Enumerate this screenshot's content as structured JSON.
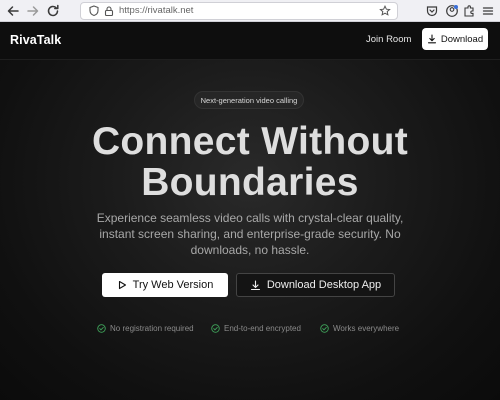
{
  "browser": {
    "url": "https://rivatalk.net",
    "icons": [
      "back-icon",
      "forward-icon",
      "reload-icon",
      "shield-icon",
      "lock-icon",
      "star-icon",
      "pocket-icon",
      "account-icon",
      "extensions-icon",
      "menu-icon"
    ]
  },
  "header": {
    "logo": "RivaTalk",
    "join_label": "Join Room",
    "download_label": "Download"
  },
  "hero": {
    "badge": "Next-generation video calling",
    "title_line1": "Connect Without",
    "title_line2": "Boundaries",
    "subtitle": "Experience seamless video calls with crystal-clear quality, instant screen sharing, and enterprise-grade security. No downloads, no hassle.",
    "primary_cta": "Try Web Version",
    "secondary_cta": "Download Desktop App",
    "features": [
      "No registration required",
      "End-to-end encrypted",
      "Works everywhere"
    ]
  },
  "colors": {
    "background": "#0d0d0d",
    "check_green": "#3fa35a",
    "button_light": "#ffffff"
  }
}
